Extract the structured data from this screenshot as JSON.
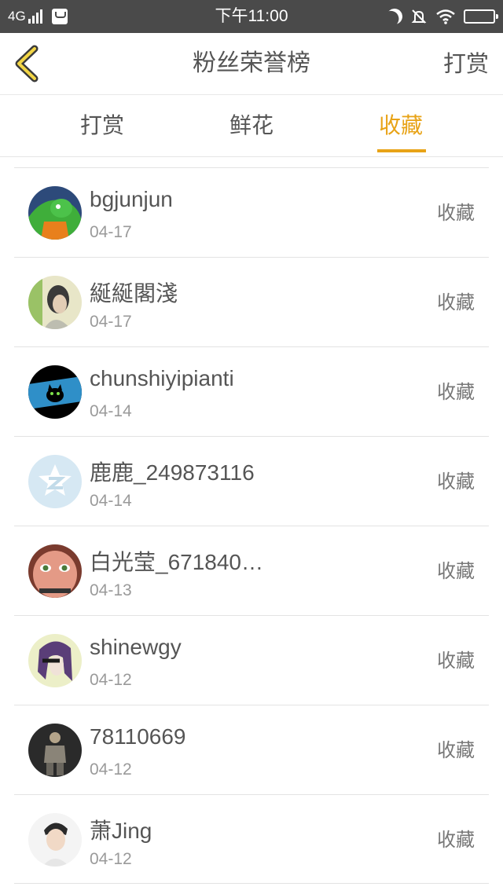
{
  "status_bar": {
    "network": "4G",
    "time": "下午11:00",
    "icons": [
      "signal-icon",
      "mailbox-icon",
      "moon-icon",
      "mute-icon",
      "wifi-icon",
      "battery-icon"
    ]
  },
  "nav": {
    "back_icon": "chevron-left-icon",
    "title": "粉丝荣誉榜",
    "action": "打赏"
  },
  "tabs": [
    {
      "label": "打赏",
      "active": false
    },
    {
      "label": "鲜花",
      "active": false
    },
    {
      "label": "收藏",
      "active": true
    }
  ],
  "accent_color": "#e8a317",
  "list": [
    {
      "username": "bgjunjun",
      "date": "04-17",
      "action": "收藏"
    },
    {
      "username": "綖綖閣淺",
      "date": "04-17",
      "action": "收藏"
    },
    {
      "username": "chunshiyipianti",
      "date": "04-14",
      "action": "收藏"
    },
    {
      "username": "鹿鹿_249873116",
      "date": "04-14",
      "action": "收藏"
    },
    {
      "username": "白光莹_671840…",
      "date": "04-13",
      "action": "收藏"
    },
    {
      "username": "shinewgy",
      "date": "04-12",
      "action": "收藏"
    },
    {
      "username": "78110669",
      "date": "04-12",
      "action": "收藏"
    },
    {
      "username": "萧Jing",
      "date": "04-12",
      "action": "收藏"
    }
  ]
}
